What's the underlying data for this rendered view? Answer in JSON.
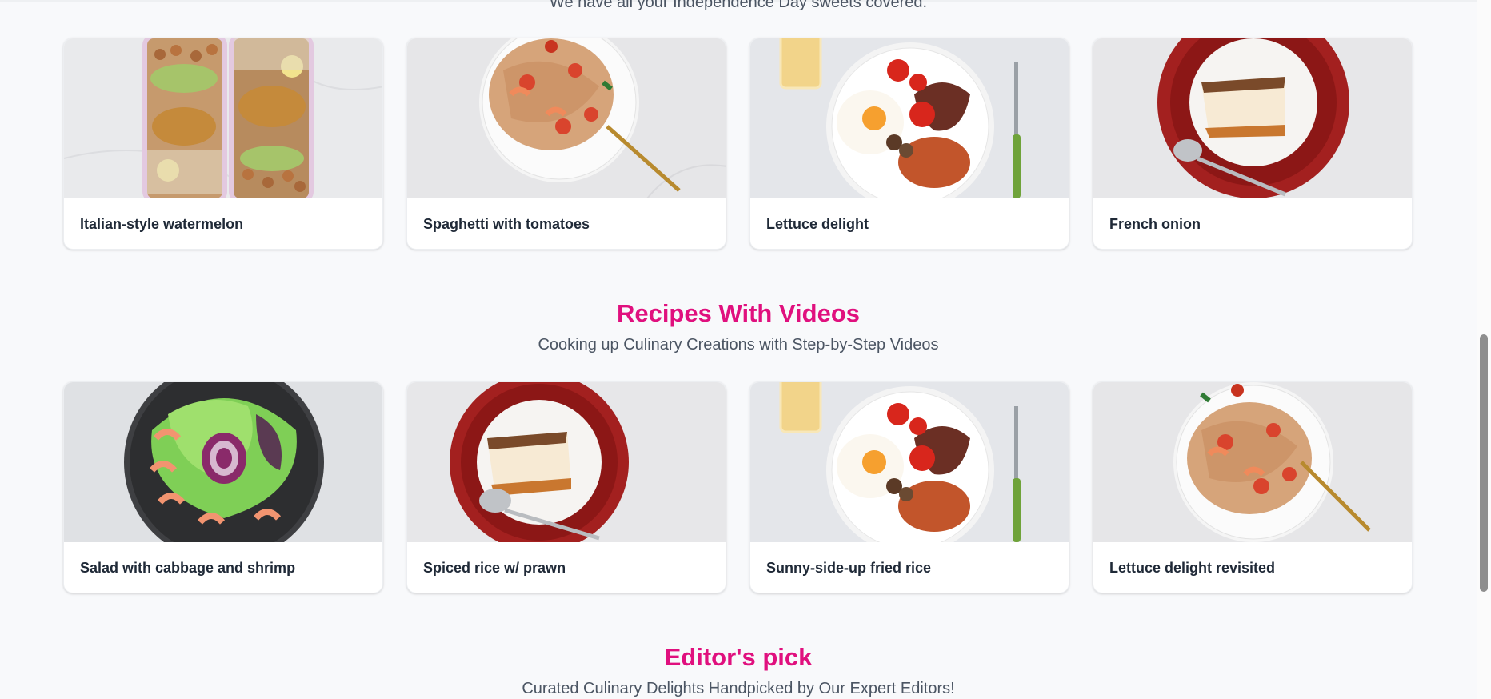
{
  "top_section": {
    "subtitle": "We have all your Independence Day sweets covered."
  },
  "row1": [
    {
      "title": "Italian-style watermelon",
      "image": "chickpea-bowls"
    },
    {
      "title": "Spaghetti with tomatoes",
      "image": "spaghetti-plate"
    },
    {
      "title": "Lettuce delight",
      "image": "breakfast-plate"
    },
    {
      "title": "French onion",
      "image": "cake-slice-plate"
    }
  ],
  "videos_section": {
    "heading": "Recipes With Videos",
    "subtitle": "Cooking up Culinary Creations with Step-by-Step Videos"
  },
  "row2": [
    {
      "title": "Salad with cabbage and shrimp",
      "image": "shrimp-salad-bowl"
    },
    {
      "title": "Spiced rice w/ prawn",
      "image": "cake-slice-plate"
    },
    {
      "title": "Sunny-side-up fried rice",
      "image": "breakfast-plate"
    },
    {
      "title": "Lettuce delight revisited",
      "image": "spaghetti-plate"
    }
  ],
  "editors_section": {
    "heading": "Editor's pick",
    "subtitle": "Curated Culinary Delights Handpicked by Our Expert Editors!"
  },
  "colors": {
    "accent": "#e0107e",
    "background": "#f8f9fb"
  }
}
